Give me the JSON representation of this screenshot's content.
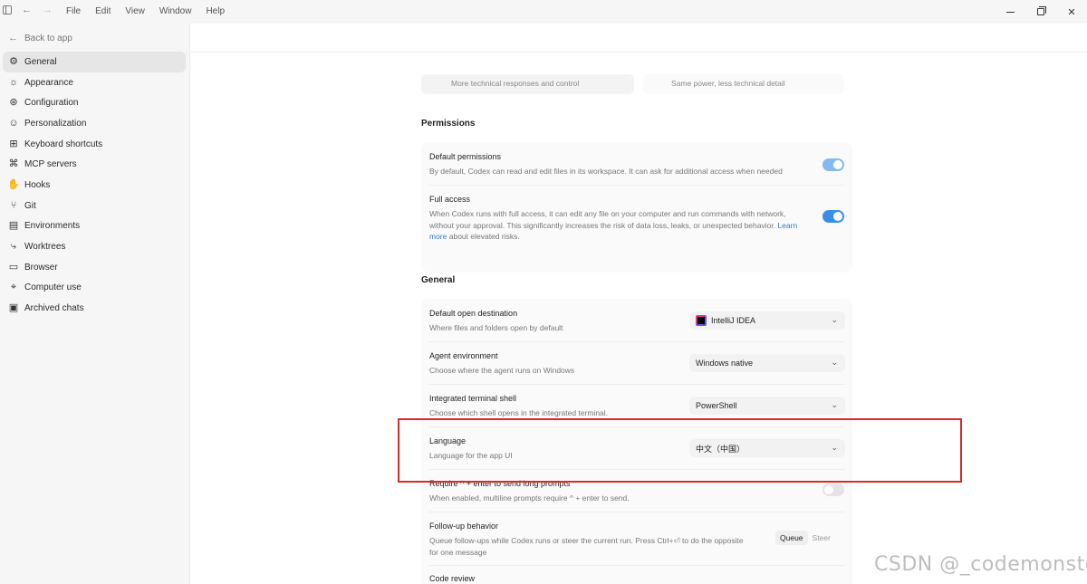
{
  "titlebar": {
    "menu": [
      "File",
      "Edit",
      "View",
      "Window",
      "Help"
    ]
  },
  "sidebar": {
    "back_label": "Back to app",
    "items": [
      {
        "label": "General",
        "icon": "gear-icon",
        "active": true
      },
      {
        "label": "Appearance",
        "icon": "sun-icon"
      },
      {
        "label": "Configuration",
        "icon": "config-icon"
      },
      {
        "label": "Personalization",
        "icon": "smile-icon"
      },
      {
        "label": "Keyboard shortcuts",
        "icon": "keyboard-icon"
      },
      {
        "label": "MCP servers",
        "icon": "mcp-icon"
      },
      {
        "label": "Hooks",
        "icon": "hook-icon"
      },
      {
        "label": "Git",
        "icon": "git-icon"
      },
      {
        "label": "Environments",
        "icon": "environment-icon"
      },
      {
        "label": "Worktrees",
        "icon": "worktree-icon"
      },
      {
        "label": "Browser",
        "icon": "browser-icon"
      },
      {
        "label": "Computer use",
        "icon": "computer-use-icon"
      },
      {
        "label": "Archived chats",
        "icon": "archive-icon"
      }
    ]
  },
  "main": {
    "partial_cards": [
      "More technical responses and control",
      "Same power, less technical detail"
    ],
    "permissions": {
      "title": "Permissions",
      "rows": [
        {
          "title": "Default permissions",
          "desc": "By default, Codex can read and edit files in its workspace. It can ask for additional access when needed",
          "toggle": "on-light"
        },
        {
          "title": "Full access",
          "desc_before": "When Codex runs with full access, it can edit any file on your computer and run commands with network, without your approval. This significantly increases the risk of data loss, leaks, or unexpected behavior. ",
          "link": "Learn more",
          "desc_after": " about elevated risks.",
          "toggle": "on"
        }
      ]
    },
    "general": {
      "title": "General",
      "rows": [
        {
          "title": "Default open destination",
          "desc": "Where files and folders open by default",
          "value": "IntelliJ IDEA"
        },
        {
          "title": "Agent environment",
          "desc": "Choose where the agent runs on Windows",
          "value": "Windows native"
        },
        {
          "title": "Integrated terminal shell",
          "desc": "Choose which shell opens in the integrated terminal.",
          "value": "PowerShell"
        },
        {
          "title": "Language",
          "desc": "Language for the app UI",
          "value": "中文（中国）"
        },
        {
          "title": "Require ^ + enter to send long prompts",
          "desc": "When enabled, multiline prompts require ^ + enter to send.",
          "toggle": "off"
        },
        {
          "title": "Follow-up behavior",
          "desc": "Queue follow-ups while Codex runs or steer the current run. Press Ctrl+⏎ to do the opposite for one message",
          "options": [
            "Queue",
            "Steer"
          ]
        },
        {
          "title": "Code review"
        }
      ]
    }
  },
  "watermark": "CSDN @_codemonster"
}
